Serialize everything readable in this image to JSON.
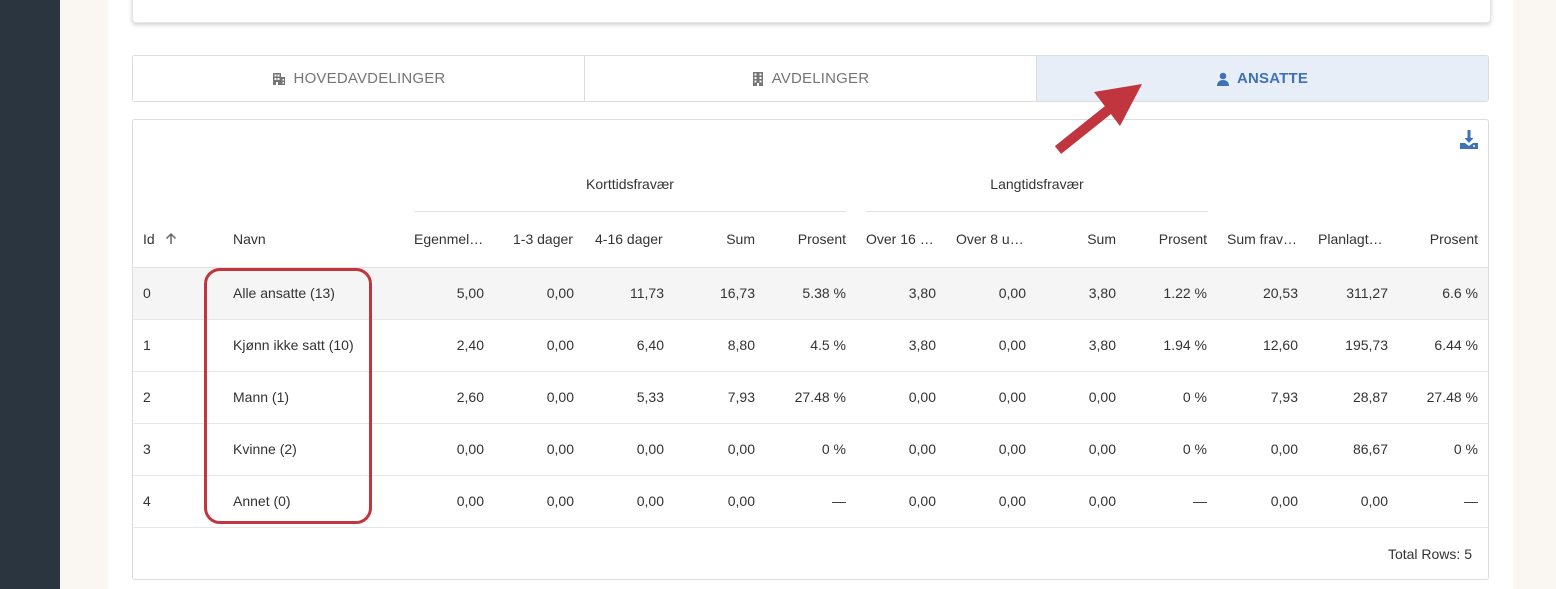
{
  "tabs": [
    {
      "label": "HOVEDAVDELINGER",
      "icon": "building-icon",
      "active": false
    },
    {
      "label": "AVDELINGER",
      "icon": "building-icon",
      "active": false
    },
    {
      "label": "ANSATTE",
      "icon": "user-icon",
      "active": true
    }
  ],
  "table": {
    "group_headers": [
      "Korttidsfravær",
      "Langtidsfravær"
    ],
    "columns": [
      "Id",
      "Navn",
      "Egenmel…",
      "1-3 dager",
      "4-16 dager",
      "Sum",
      "Prosent",
      "Over 16 …",
      "Over 8 u…",
      "Sum",
      "Prosent",
      "Sum frav…",
      "Planlagt…",
      "Prosent"
    ],
    "sort": {
      "column": "Id",
      "direction": "ascending",
      "icon": "arrow-up-icon"
    },
    "rows": [
      [
        "0",
        "Alle ansatte (13)",
        "5,00",
        "0,00",
        "11,73",
        "16,73",
        "5.38 %",
        "3,80",
        "0,00",
        "3,80",
        "1.22 %",
        "20,53",
        "311,27",
        "6.6 %"
      ],
      [
        "1",
        "Kjønn ikke satt (10)",
        "2,40",
        "0,00",
        "6,40",
        "8,80",
        "4.5 %",
        "3,80",
        "0,00",
        "3,80",
        "1.94 %",
        "12,60",
        "195,73",
        "6.44 %"
      ],
      [
        "2",
        "Mann (1)",
        "2,60",
        "0,00",
        "5,33",
        "7,93",
        "27.48 %",
        "0,00",
        "0,00",
        "0,00",
        "0 %",
        "7,93",
        "28,87",
        "27.48 %"
      ],
      [
        "3",
        "Kvinne (2)",
        "0,00",
        "0,00",
        "0,00",
        "0,00",
        "0 %",
        "0,00",
        "0,00",
        "0,00",
        "0 %",
        "0,00",
        "86,67",
        "0 %"
      ],
      [
        "4",
        "Annet (0)",
        "0,00",
        "0,00",
        "0,00",
        "0,00",
        "—",
        "0,00",
        "0,00",
        "0,00",
        "—",
        "0,00",
        "0,00",
        "—"
      ]
    ],
    "footer": "Total Rows: 5",
    "download_icon": "download-icon"
  },
  "annotations": {
    "highlight_color": "#c0353e",
    "arrow_color": "#c0353e",
    "arrow_icon": "arrow-icon"
  },
  "colors": {
    "accent": "#3f72b5",
    "active_tab_bg": "#e8eef7",
    "sidebar": "#2a3540"
  }
}
